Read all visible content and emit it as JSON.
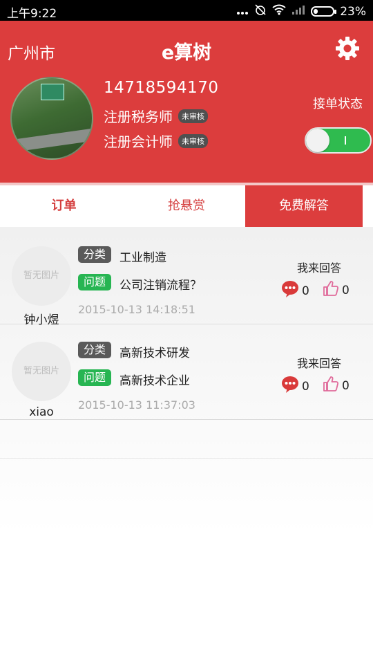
{
  "status_bar": {
    "time": "上午9:22",
    "battery": "23%",
    "battery_level": 0.23
  },
  "header": {
    "city": "广州市",
    "title": "e算树",
    "phone": "14718594170",
    "reg_tax": "注册税务师",
    "reg_tax_badge": "未审核",
    "reg_acc": "注册会计师",
    "reg_acc_badge": "未审核",
    "order_status_label": "接单状态",
    "toggle_on": true
  },
  "tabs": [
    {
      "label": "订单"
    },
    {
      "label": "抢悬赏"
    },
    {
      "label": "免费解答",
      "active": true
    }
  ],
  "items": [
    {
      "placeholder": "暂无图片",
      "username": "钟小煜",
      "category_tag": "分类",
      "category": "工业制造",
      "question_tag": "问题",
      "question": "公司注销流程？",
      "date": "2015-10-13 14:18:51",
      "answer_label": "我来回答",
      "comments": "0",
      "likes": "0"
    },
    {
      "placeholder": "暂无图片",
      "username": "xiao",
      "category_tag": "分类",
      "category": "高新技术研发",
      "question_tag": "问题",
      "question": "高新技术企业",
      "date": "2015-10-13 11:37:03",
      "answer_label": "我来回答",
      "comments": "0",
      "likes": "0"
    }
  ],
  "colors": {
    "primary": "#dc3d3d",
    "green": "#27b552",
    "toggle_green": "#2fbb4f"
  }
}
